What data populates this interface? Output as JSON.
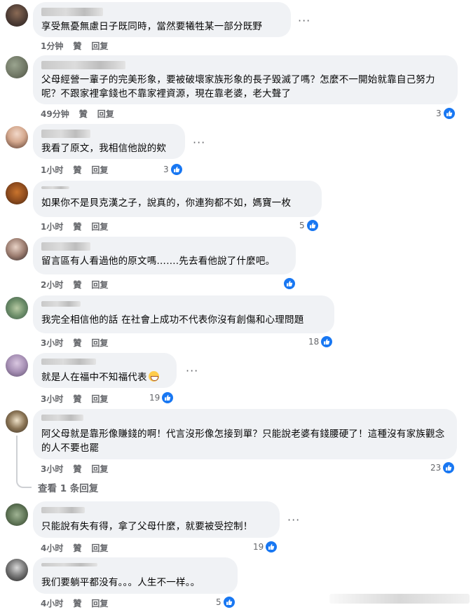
{
  "labels": {
    "like": "贊",
    "reply": "回复",
    "more": "···"
  },
  "comments": [
    {
      "time": "1分钟",
      "text": "享受無憂無慮日子既同時，當然要犧牲某一部分既野",
      "reactions": ""
    },
    {
      "time": "49分钟",
      "text": "父母經營一輩子的完美形象，要被破壞家族形象的長子毀滅了嗎？怎麼不一開始就靠自己努力呢？不跟家裡拿錢也不靠家裡資源，現在靠老婆，老大聲了",
      "reactions": "3"
    },
    {
      "time": "1小时",
      "text": "我看了原文，我相信他說的欸",
      "reactions": "3"
    },
    {
      "time": "1小时",
      "text": "如果你不是貝克漢之子，說真的，你連狗都不如，媽寶一枚",
      "reactions": "5"
    },
    {
      "time": "2小时",
      "text": "留言區有人看過他的原文嗎…….先去看他說了什麼吧。",
      "reactions": ""
    },
    {
      "time": "3小时",
      "text": "我完全相信他的話 在社會上成功不代表你沒有創傷和心理問題",
      "reactions": "18"
    },
    {
      "time": "3小时",
      "text": "就是人在福中不知福代表",
      "reactions": "19"
    },
    {
      "time": "3小时",
      "text": "阿父母就是靠形像賺錢的啊！代言沒形像怎接到單？只能說老婆有錢腰硬了！這種沒有家族觀念的人不要也罷",
      "reactions": "23"
    },
    {
      "time": "4小时",
      "text": "只能說有失有得，拿了父母什麼，就要被受控制！",
      "reactions": "19"
    },
    {
      "time": "4小时",
      "text": "我们要躺平都没有。。。人生不一样。。",
      "reactions": "5"
    }
  ],
  "view_replies": "查看 1 条回复",
  "colors": {
    "accent": "#1877f2",
    "bubble": "#f0f2f5",
    "meta": "#65676b"
  }
}
